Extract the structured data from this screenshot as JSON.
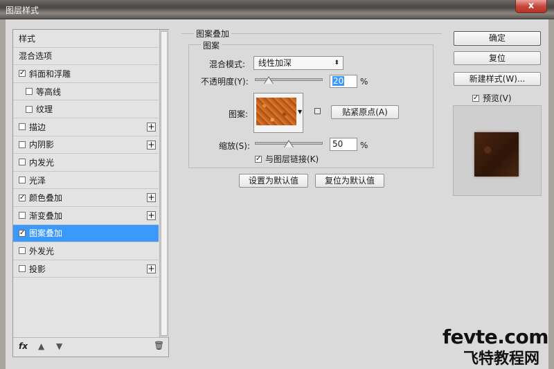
{
  "window": {
    "title": "图层样式",
    "close_label": "x"
  },
  "sidebar": {
    "items": [
      {
        "label": "样式",
        "checkbox": false,
        "checked": false,
        "sub": false,
        "plus": false,
        "selected": false
      },
      {
        "label": "混合选项",
        "checkbox": false,
        "checked": false,
        "sub": false,
        "plus": false,
        "selected": false
      },
      {
        "label": "斜面和浮雕",
        "checkbox": true,
        "checked": true,
        "sub": false,
        "plus": false,
        "selected": false
      },
      {
        "label": "等高线",
        "checkbox": true,
        "checked": false,
        "sub": true,
        "plus": false,
        "selected": false
      },
      {
        "label": "纹理",
        "checkbox": true,
        "checked": false,
        "sub": true,
        "plus": false,
        "selected": false
      },
      {
        "label": "描边",
        "checkbox": true,
        "checked": false,
        "sub": false,
        "plus": true,
        "selected": false
      },
      {
        "label": "内阴影",
        "checkbox": true,
        "checked": false,
        "sub": false,
        "plus": true,
        "selected": false
      },
      {
        "label": "内发光",
        "checkbox": true,
        "checked": false,
        "sub": false,
        "plus": false,
        "selected": false
      },
      {
        "label": "光泽",
        "checkbox": true,
        "checked": false,
        "sub": false,
        "plus": false,
        "selected": false
      },
      {
        "label": "颜色叠加",
        "checkbox": true,
        "checked": true,
        "sub": false,
        "plus": true,
        "selected": false
      },
      {
        "label": "渐变叠加",
        "checkbox": true,
        "checked": false,
        "sub": false,
        "plus": true,
        "selected": false
      },
      {
        "label": "图案叠加",
        "checkbox": true,
        "checked": true,
        "sub": false,
        "plus": false,
        "selected": true
      },
      {
        "label": "外发光",
        "checkbox": true,
        "checked": false,
        "sub": false,
        "plus": false,
        "selected": false
      },
      {
        "label": "投影",
        "checkbox": true,
        "checked": false,
        "sub": false,
        "plus": true,
        "selected": false
      }
    ],
    "bottom": {
      "fx_label": "fx",
      "up_icon": "arrow-up-icon",
      "down_icon": "arrow-down-icon",
      "trash_icon": "trash-icon"
    }
  },
  "panel": {
    "section_title": "图案叠加",
    "group_title": "图案",
    "blend_mode_label": "混合模式:",
    "blend_mode_value": "线性加深",
    "opacity_label": "不透明度(Y):",
    "opacity_value": "20",
    "opacity_unit": "%",
    "opacity_level": 0.2,
    "pattern_label": "图案:",
    "snap_button": "贴紧原点(A)",
    "scale_label": "缩放(S):",
    "scale_value": "50",
    "scale_unit": "%",
    "scale_level": 0.5,
    "link_label": "与图层链接(K)",
    "link_checked": true,
    "set_default_button": "设置为默认值",
    "reset_default_button": "复位为默认值"
  },
  "actions": {
    "ok": "确定",
    "reset": "复位",
    "new_style": "新建样式(W)...",
    "preview_label": "预览(V)",
    "preview_checked": true
  },
  "watermark": {
    "line1": "fevte.com",
    "line2": "飞特教程网"
  },
  "colors": {
    "selection": "#3b99fc",
    "dialog_bg": "#dadada"
  }
}
